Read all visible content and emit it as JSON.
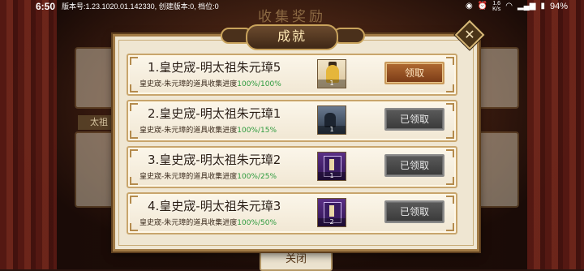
{
  "status_bar": {
    "time": "6:50",
    "version_text": "版本号:1.23.1020.01.142330, 创建版本:0, 档位:0",
    "network_speed_value": "1.6",
    "network_speed_unit": "K/s",
    "battery": "94%"
  },
  "background": {
    "title": "收集奖励",
    "label": "太祖",
    "close_label": "关闭"
  },
  "dialog": {
    "title": "成就",
    "rows": [
      {
        "title": "1.皇史宬-明太祖朱元璋5",
        "desc": "皇史宬-朱元璋的道具收集进度",
        "progress": "100%/100%",
        "item_count": "1",
        "button": "领取",
        "claimed": false
      },
      {
        "title": "2.皇史宬-明太祖朱元璋1",
        "desc": "皇史宬-朱元璋的道具收集进度",
        "progress": "100%/15%",
        "item_count": "1",
        "button": "已领取",
        "claimed": true
      },
      {
        "title": "3.皇史宬-明太祖朱元璋2",
        "desc": "皇史宬-朱元璋的道具收集进度",
        "progress": "100%/25%",
        "item_count": "1",
        "button": "已领取",
        "claimed": true
      },
      {
        "title": "4.皇史宬-明太祖朱元璋3",
        "desc": "皇史宬-朱元璋的道具收集进度",
        "progress": "100%/50%",
        "item_count": "2",
        "button": "已领取",
        "claimed": true
      }
    ]
  },
  "colors": {
    "progress_green": "#2c9a3c",
    "claim_button": "#9a5226",
    "claimed_button": "#4a4a4a"
  }
}
